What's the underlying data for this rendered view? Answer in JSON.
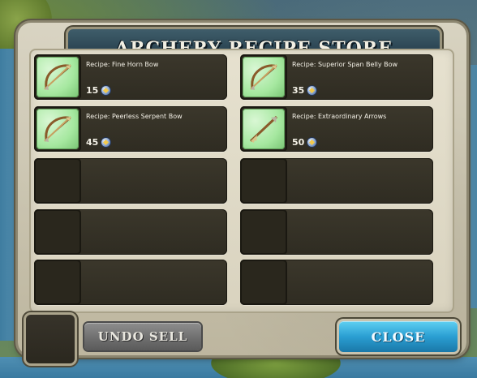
{
  "window": {
    "title": "Archery Recipe Store"
  },
  "recipes": [
    {
      "name": "Recipe: Fine Horn Bow",
      "price": "15",
      "icon": "recipe-scroll-bow-icon"
    },
    {
      "name": "Recipe: Superior Span Belly Bow",
      "price": "35",
      "icon": "recipe-scroll-bow-icon"
    },
    {
      "name": "Recipe: Peerless Serpent Bow",
      "price": "45",
      "icon": "recipe-scroll-bow-icon"
    },
    {
      "name": "Recipe: Extraordinary Arrows",
      "price": "50",
      "icon": "recipe-scroll-arrow-icon"
    }
  ],
  "currency_icon": "coin-icon",
  "empty_slots": 6,
  "buttons": {
    "undo_sell": "Undo Sell",
    "close": "Close"
  },
  "colors": {
    "title_banner": "#2c4654",
    "close_button": "#2a9ed2",
    "undo_button": "#6f6f6f",
    "slot_background": "#2f2c22",
    "scroll_green": "#a6e8a0"
  }
}
